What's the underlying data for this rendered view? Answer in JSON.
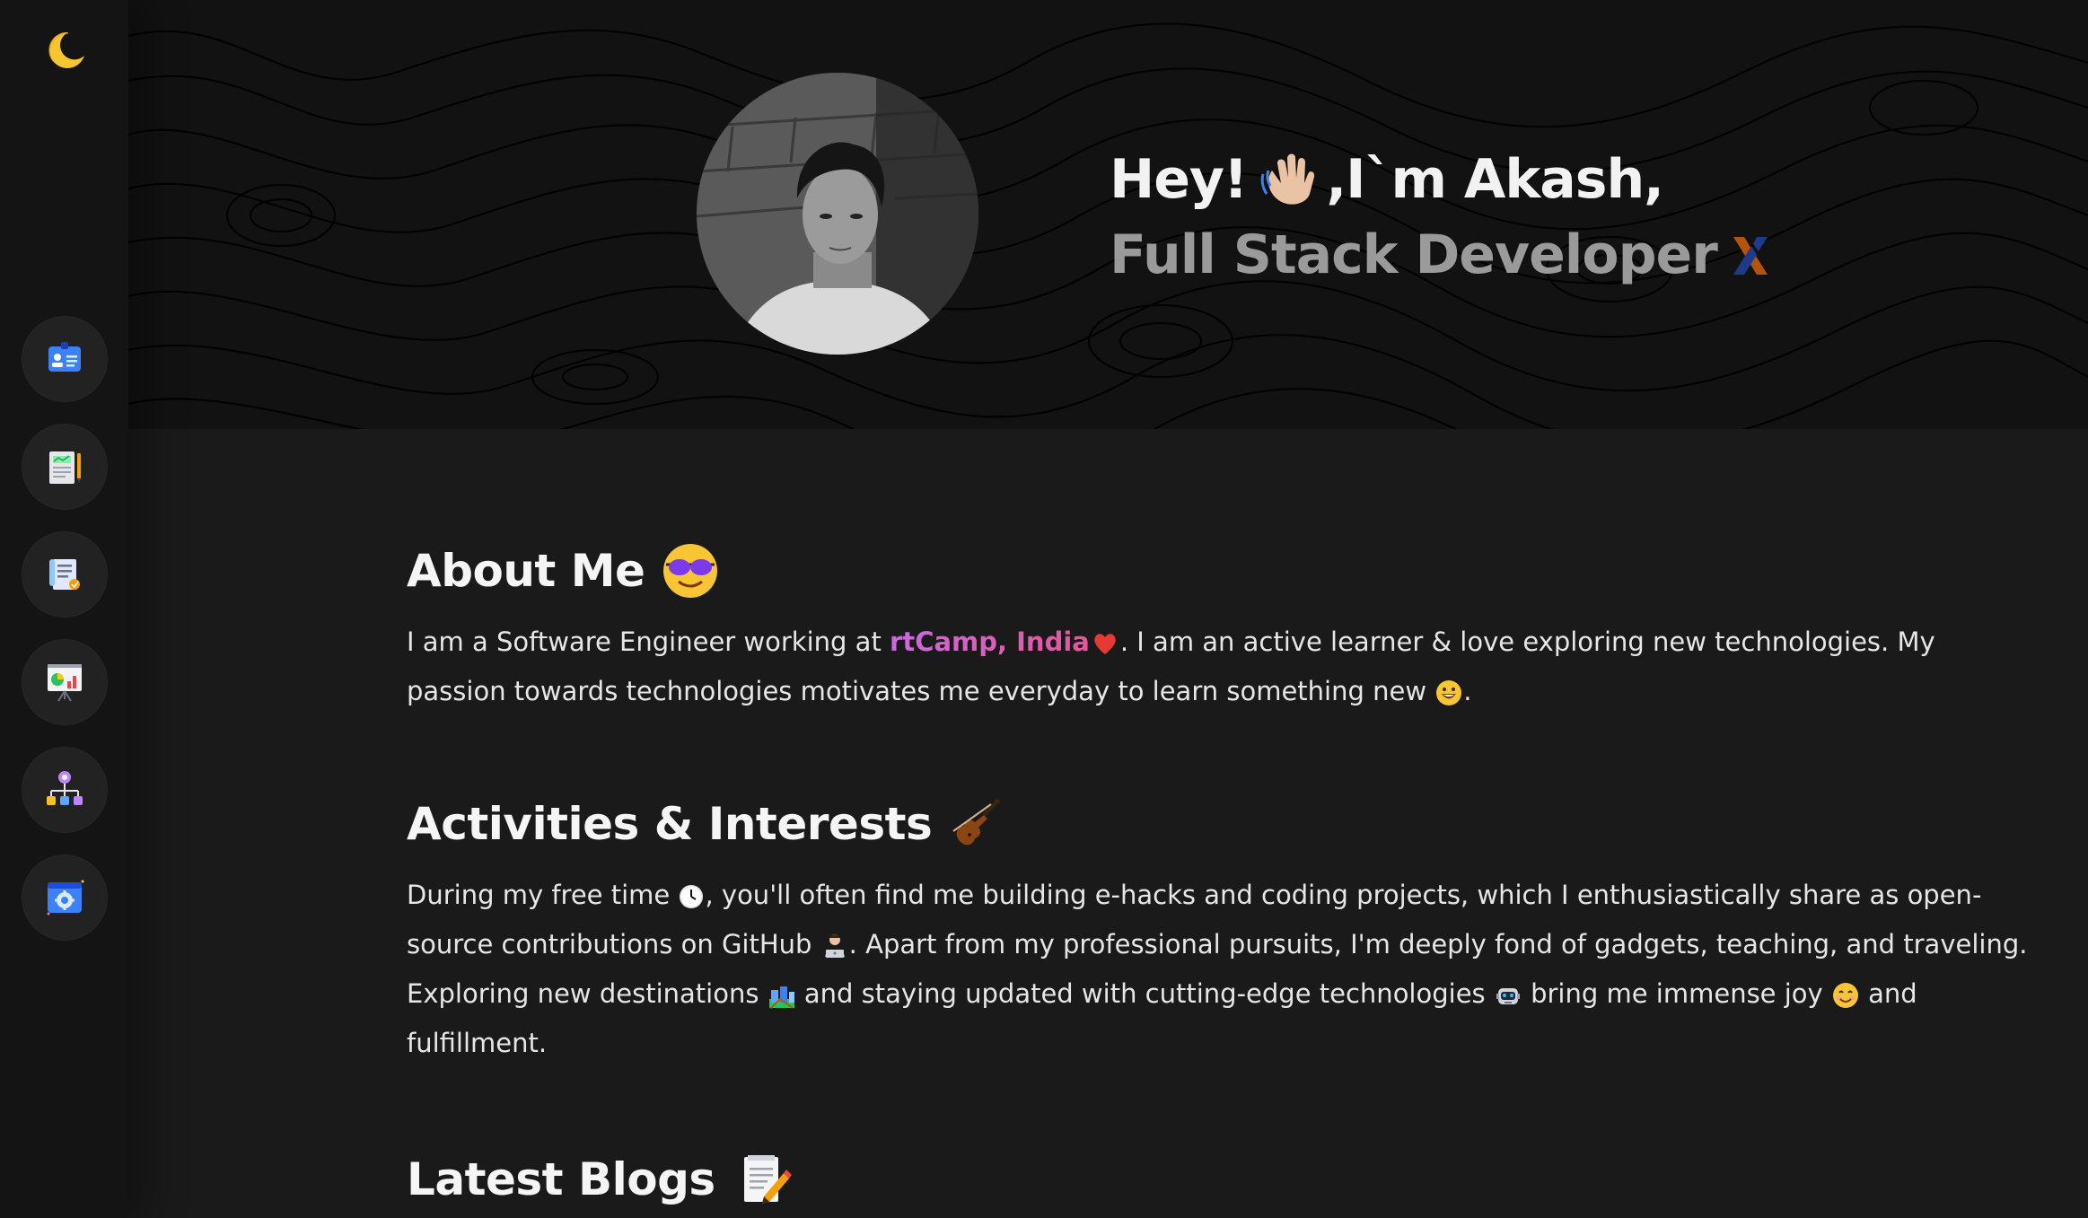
{
  "colors": {
    "background": "#1a1a1a",
    "hero_background": "#121212",
    "sidebar": "#141414",
    "heading": "#f5f5f5",
    "subtitle": "#9a9a9a",
    "highlight_start": "#c86bdc",
    "highlight_end": "#e8559a"
  },
  "sidebar": {
    "theme_icon": "crescent-moon-icon",
    "items": [
      {
        "name": "id-card",
        "icon": "id-badge-icon"
      },
      {
        "name": "resume",
        "icon": "document-chart-icon"
      },
      {
        "name": "blogs",
        "icon": "scroll-document-icon"
      },
      {
        "name": "presentations",
        "icon": "presentation-board-icon"
      },
      {
        "name": "organization",
        "icon": "org-chart-icon"
      },
      {
        "name": "web-settings",
        "icon": "browser-gear-icon"
      }
    ]
  },
  "hero": {
    "greeting_prefix": "Hey!",
    "greeting_suffix": ",I`m Akash,",
    "wave_icon": "waving-hand-icon",
    "role": "Full Stack Developer",
    "role_icon": "devto-x-icon",
    "avatar": "profile-photo"
  },
  "about": {
    "title": "About Me",
    "title_icon": "sunglasses-face-icon",
    "text_before": "I am a Software Engineer working at ",
    "highlight": "rtCamp, India",
    "heart_icon": "red-heart-icon",
    "text_after": ". I am an active learner & love exploring new technologies. My passion towards technologies motivates me everyday to learn something new ",
    "end_icon": "grinning-face-icon",
    "text_end": "."
  },
  "activities": {
    "title": "Activities & Interests",
    "title_icon": "violin-icon",
    "part1": "During my free time ",
    "clock_icon": "clock-icon",
    "part2": ", you'll often find me building e-hacks and coding projects, which I enthusiastically share as open-source contributions on GitHub ",
    "coder_icon": "technologist-icon",
    "part3": ". Apart from my professional pursuits, I'm deeply fond of gadgets, teaching, and traveling. Exploring new destinations ",
    "travel_icon": "railway-icon",
    "part4": " and staying updated with cutting-edge technologies ",
    "robot_icon": "robot-icon",
    "part5": " bring me immense joy ",
    "smile_icon": "smiling-face-icon",
    "part6": " and fulfillment."
  },
  "blogs": {
    "title": "Latest Blogs",
    "title_icon": "memo-pencil-icon"
  }
}
